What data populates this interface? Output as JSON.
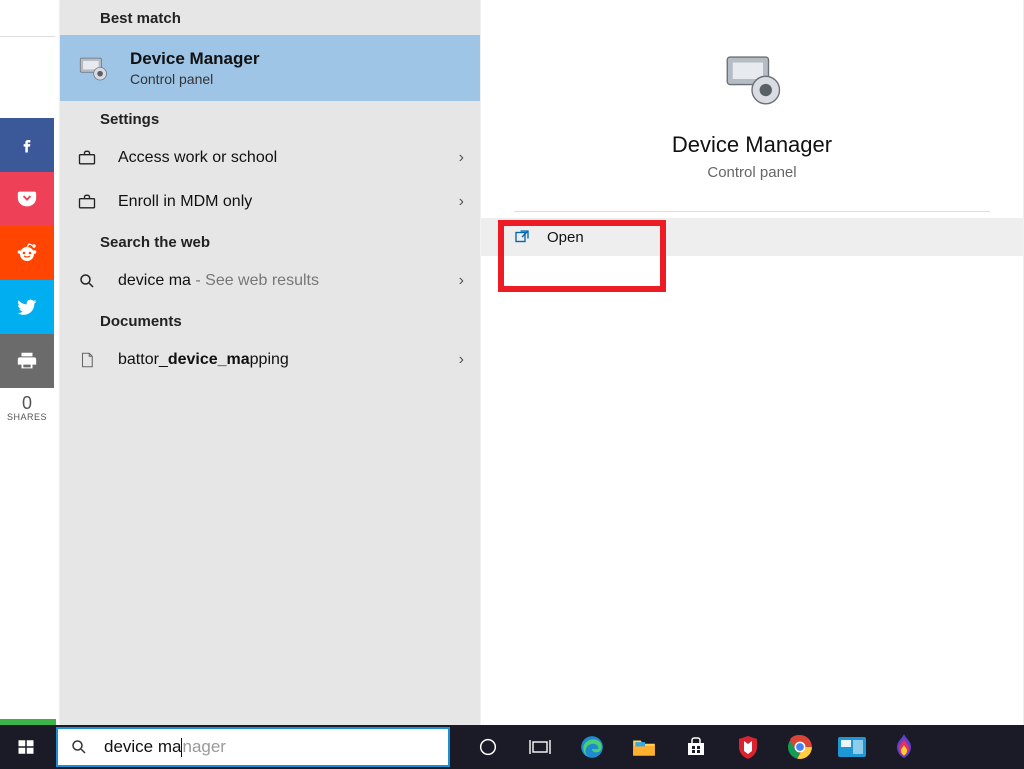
{
  "share": {
    "count": "0",
    "count_label": "SHARES"
  },
  "sections": {
    "best_match": "Best match",
    "settings": "Settings",
    "web": "Search the web",
    "documents": "Documents"
  },
  "best_match": {
    "title": "Device Manager",
    "subtitle": "Control panel"
  },
  "settings_items": [
    {
      "label": "Access work or school"
    },
    {
      "label": "Enroll in MDM only"
    }
  ],
  "web_item": {
    "query": "device ma",
    "hint_prefix": " - ",
    "hint": "See web results"
  },
  "documents_item": {
    "pre": "battor_",
    "bold": "device_ma",
    "post": "pping"
  },
  "detail": {
    "title": "Device Manager",
    "subtitle": "Control panel",
    "action_open": "Open"
  },
  "search": {
    "typed": "device ma",
    "ghost_rest": "nager"
  }
}
